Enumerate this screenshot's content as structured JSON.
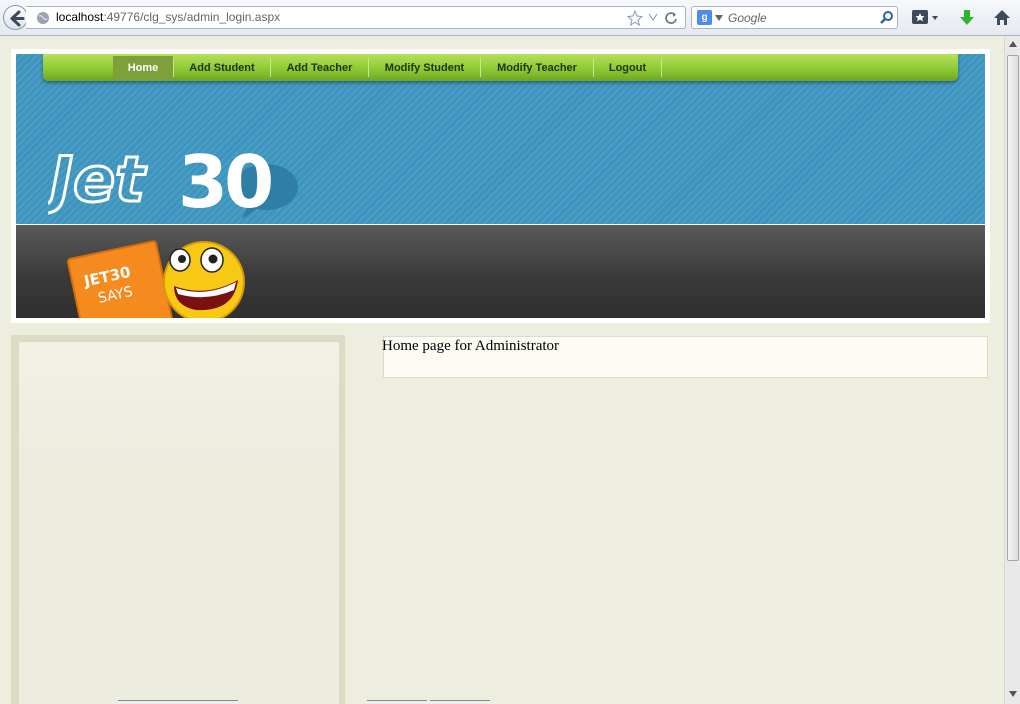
{
  "browser": {
    "url_host": "localhost",
    "url_path": ":49776/clg_sys/admin_login.aspx",
    "search_placeholder": "Google",
    "search_engine_letter": "g"
  },
  "nav": {
    "items": [
      {
        "label": "Home"
      },
      {
        "label": "Add Student"
      },
      {
        "label": "Add Teacher"
      },
      {
        "label": "Modify Student"
      },
      {
        "label": "Modify Teacher"
      },
      {
        "label": "Logout"
      }
    ]
  },
  "logo": {
    "text_outline": "Jet",
    "text_solid": "30"
  },
  "mascot": {
    "sign_line1": "JET30",
    "sign_line2": "SAYS"
  },
  "content": {
    "heading": "Home page for Administrator"
  },
  "colors": {
    "banner": "#4a9ec6",
    "nav_green": "#8cc632",
    "nav_active": "#7ea03a",
    "page_bg": "#eeeedf"
  }
}
